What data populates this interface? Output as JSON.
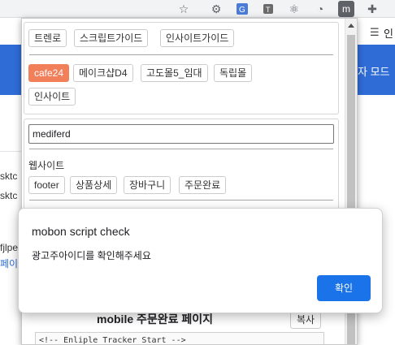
{
  "browser": {
    "toolbar_icons": [
      "star-icon",
      "settings-gear-icon",
      "translate-icon",
      "extension-icon",
      "react-devtools-icon",
      "timer-icon",
      "mobon-extension-icon",
      "puzzle-icon"
    ],
    "mobon_icon_letter": "m"
  },
  "background_page": {
    "mode_text": "자 모드",
    "list_text": "인",
    "fragments": [
      "sktc",
      "sktc",
      "fjlpe",
      "페이"
    ]
  },
  "popup": {
    "guide_buttons": [
      "트렌로",
      "스크립트가이드",
      "인사이트가이드"
    ],
    "platform_buttons": [
      "cafe24",
      "메이크샵D4",
      "고도몰5_임대",
      "독립몰",
      "인사이트"
    ],
    "active_platform": "cafe24",
    "advertiser_id_value": "mediferd",
    "website_label": "웹사이트",
    "page_buttons": [
      "footer",
      "상품상세",
      "장바구니",
      "주문완료"
    ],
    "bottom_title": "mobile 주문완료 페이지",
    "copy_button": "복사",
    "code_line": "<!-- Enliple Tracker Start -->"
  },
  "dialog": {
    "title": "mobon script check",
    "message": "광고주아이디를 확인해주세요",
    "ok_button": "확인"
  },
  "colors": {
    "active_button": "#f07f5a",
    "primary_blue": "#1a73e8",
    "page_blue": "#2f6cd6"
  }
}
